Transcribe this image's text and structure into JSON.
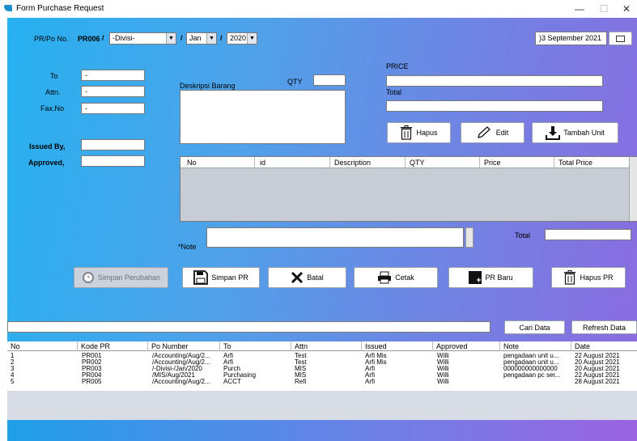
{
  "window": {
    "title": "Form Purchase Request",
    "minimize": "—",
    "maximize": "☐",
    "close": "✕"
  },
  "header": {
    "prpo_label": "PR/Po No.",
    "pr_code": "PR006",
    "sep1": "/",
    "divisi": "-Divisi-",
    "sep2": "/",
    "month": "Jan",
    "sep3": "/",
    "year": "2020",
    "date": ")3 September 2021"
  },
  "form": {
    "to_label": "To",
    "to_value": "-",
    "attn_label": "Attn.",
    "attn_value": "-",
    "fax_label": "Fax.No",
    "fax_value": "-",
    "issued_label": "Issued By,",
    "issued_value": "",
    "approved_label": "Approved,",
    "approved_value": "",
    "deskripsi_label": "Deskripsi Barang",
    "qty_label": "QTY",
    "qty_value": "",
    "price_label": "PRICE",
    "price_value": "",
    "total_label": "Total",
    "total_value": "",
    "note_label": "*Note",
    "note_value": "",
    "grand_total_label": "Total",
    "grand_total_value": ""
  },
  "item_buttons": {
    "hapus": "Hapus",
    "edit": "Edit",
    "tambah": "Tambah Unit"
  },
  "item_table": {
    "columns": [
      "No",
      "id",
      "Description",
      "QTY",
      "Price",
      "Total Price"
    ]
  },
  "actions": {
    "simpan_perubahan": "Simpan Perubahan",
    "simpan_pr": "Simpan PR",
    "batal": "Batal",
    "cetak": "Cetak",
    "pr_baru": "PR Baru",
    "hapus_pr": "Hapus PR"
  },
  "search": {
    "value": "",
    "cari": "Cari Data",
    "refresh": "Refresh Data"
  },
  "pr_list": {
    "columns": [
      "No",
      "Kode PR",
      "Po Number",
      "To",
      "Attn",
      "Issued",
      "Approved",
      "Note",
      "Date"
    ],
    "rows": [
      [
        "1",
        "PR001",
        "/Accounting/Aug/2...",
        "Arfi",
        "Test",
        "Arfi Mis",
        "Willi",
        "pengadaan unit u...",
        "22 August 2021"
      ],
      [
        "2",
        "PR002",
        "/Accounting/Aug/2...",
        "Arfi",
        "Test",
        "Arfi Mis",
        "Willi",
        "pengadaan unit u...",
        "20 August 2021"
      ],
      [
        "3",
        "PR003",
        "/-Divisi-/Jan/2020",
        "Purch",
        "MIS",
        "Arfi",
        "Willi",
        "000000000000000",
        "20 August 2021"
      ],
      [
        "4",
        "PR004",
        "/MIS/Aug/2021",
        "Purchasing",
        "MIS",
        "Arfi",
        "Willi",
        "pengadaan pc ser...",
        "22 August 2021"
      ],
      [
        "5",
        "PR005",
        "/Accounting/Aug/2...",
        "ACCT",
        "Refi",
        "Arfi",
        "Willi",
        "",
        "28 August 2021"
      ]
    ]
  },
  "icons": {
    "app": "app-logo-icon",
    "calendar": "calendar-icon",
    "trash": "trash-icon",
    "pencil": "pencil-icon",
    "download": "download-icon",
    "clock": "clock-icon",
    "save": "save-icon",
    "close": "x-icon",
    "print": "print-icon",
    "new": "new-document-icon"
  },
  "colors": {
    "gradient_start": "#26b1f0",
    "gradient_end": "#8c6ae0",
    "panel_gray": "#c8ccd4"
  }
}
